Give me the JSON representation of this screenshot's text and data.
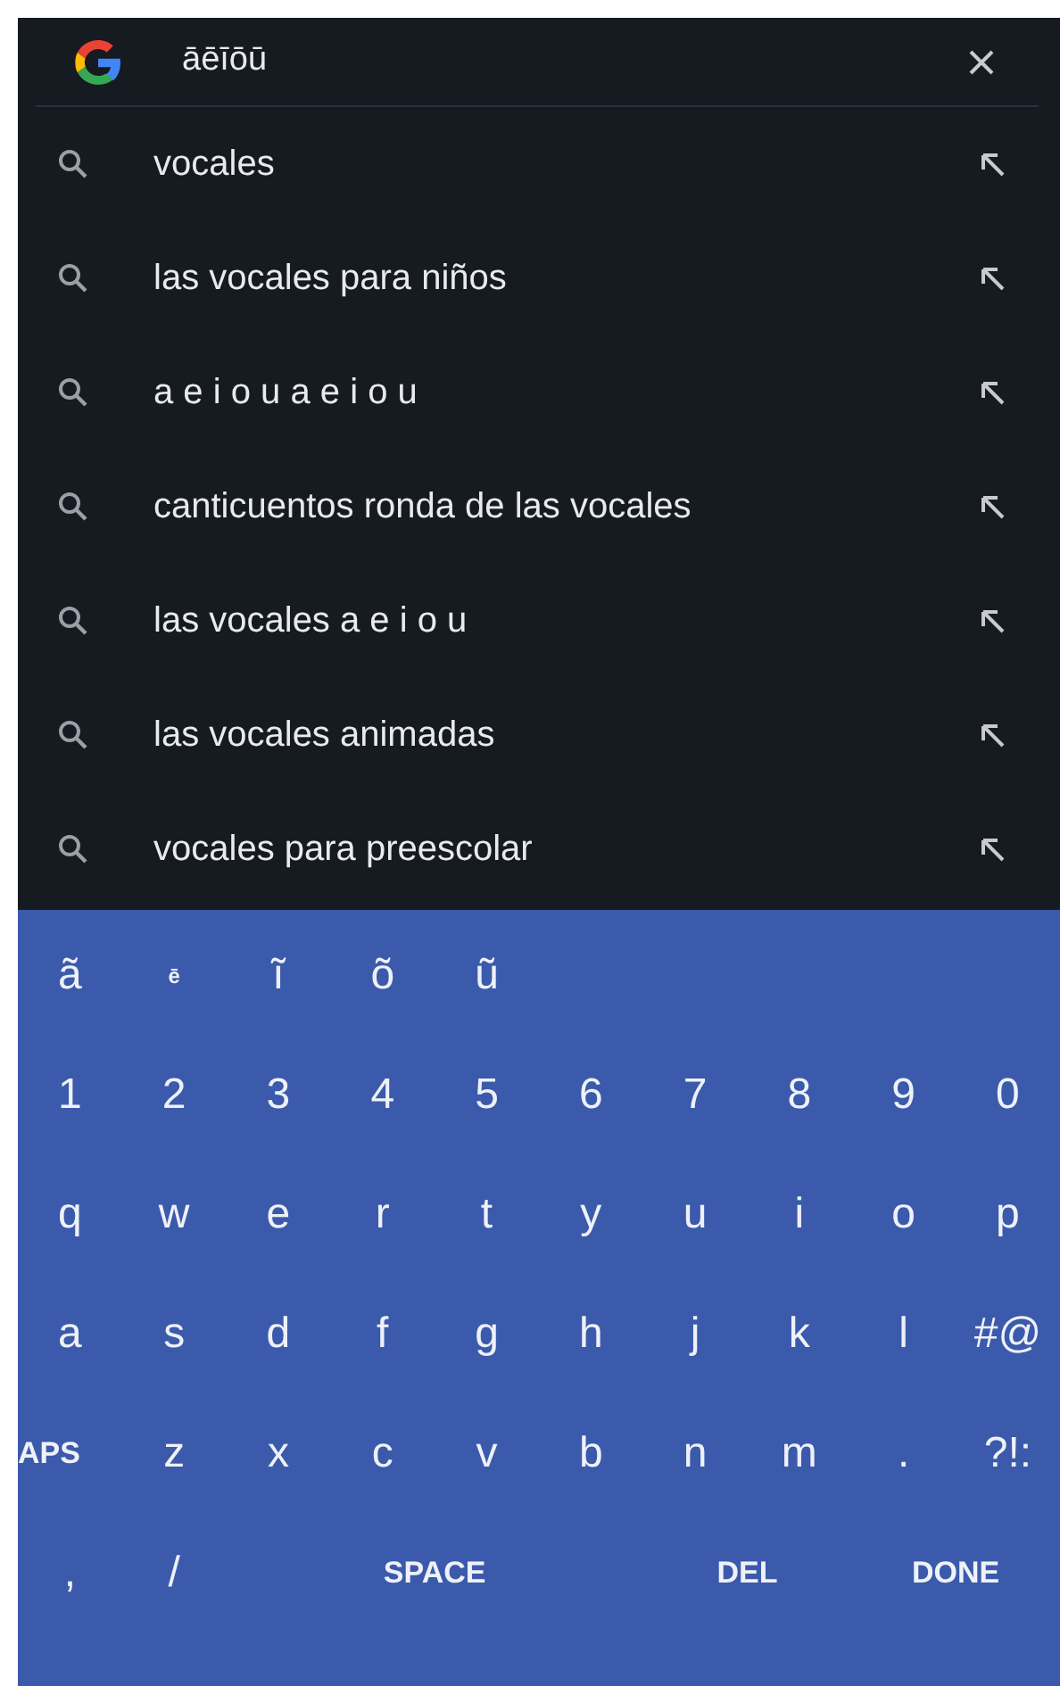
{
  "search": {
    "query": "āēīōū"
  },
  "suggestions": [
    "vocales",
    "las vocales para niños",
    "a e i o u a e i o u",
    "canticuentos ronda de las vocales",
    "las vocales a e i o u",
    "las vocales animadas",
    "vocales para preescolar"
  ],
  "keyboard": {
    "rows": [
      [
        {
          "kind": "char",
          "label": "ã"
        },
        {
          "kind": "small",
          "label": "ē"
        },
        {
          "kind": "char",
          "label": "ĩ"
        },
        {
          "kind": "char",
          "label": "õ"
        },
        {
          "kind": "char",
          "label": "ũ"
        }
      ],
      [
        {
          "kind": "char",
          "label": "1"
        },
        {
          "kind": "char",
          "label": "2"
        },
        {
          "kind": "char",
          "label": "3"
        },
        {
          "kind": "char",
          "label": "4"
        },
        {
          "kind": "char",
          "label": "5"
        },
        {
          "kind": "char",
          "label": "6"
        },
        {
          "kind": "char",
          "label": "7"
        },
        {
          "kind": "char",
          "label": "8"
        },
        {
          "kind": "char",
          "label": "9"
        },
        {
          "kind": "char",
          "label": "0"
        }
      ],
      [
        {
          "kind": "char",
          "label": "q"
        },
        {
          "kind": "char",
          "label": "w"
        },
        {
          "kind": "char",
          "label": "e"
        },
        {
          "kind": "char",
          "label": "r"
        },
        {
          "kind": "char",
          "label": "t"
        },
        {
          "kind": "char",
          "label": "y"
        },
        {
          "kind": "char",
          "label": "u"
        },
        {
          "kind": "char",
          "label": "i"
        },
        {
          "kind": "char",
          "label": "o"
        },
        {
          "kind": "char",
          "label": "p"
        }
      ],
      [
        {
          "kind": "char",
          "label": "a"
        },
        {
          "kind": "char",
          "label": "s"
        },
        {
          "kind": "char",
          "label": "d"
        },
        {
          "kind": "char",
          "label": "f"
        },
        {
          "kind": "char",
          "label": "g"
        },
        {
          "kind": "char",
          "label": "h"
        },
        {
          "kind": "char",
          "label": "j"
        },
        {
          "kind": "char",
          "label": "k"
        },
        {
          "kind": "char",
          "label": "l"
        },
        {
          "kind": "char",
          "label": "#@"
        }
      ],
      [
        {
          "kind": "caps",
          "label": "APS"
        },
        {
          "kind": "char",
          "label": "z"
        },
        {
          "kind": "char",
          "label": "x"
        },
        {
          "kind": "char",
          "label": "c"
        },
        {
          "kind": "char",
          "label": "v"
        },
        {
          "kind": "char",
          "label": "b"
        },
        {
          "kind": "char",
          "label": "n"
        },
        {
          "kind": "char",
          "label": "m"
        },
        {
          "kind": "char",
          "label": "."
        },
        {
          "kind": "char",
          "label": "?!:"
        }
      ],
      [
        {
          "kind": "char",
          "label": ","
        },
        {
          "kind": "char",
          "label": "/"
        },
        {
          "kind": "space",
          "label": "SPACE"
        },
        {
          "kind": "command",
          "label": "DEL"
        },
        {
          "kind": "command",
          "label": "DONE"
        }
      ]
    ]
  }
}
